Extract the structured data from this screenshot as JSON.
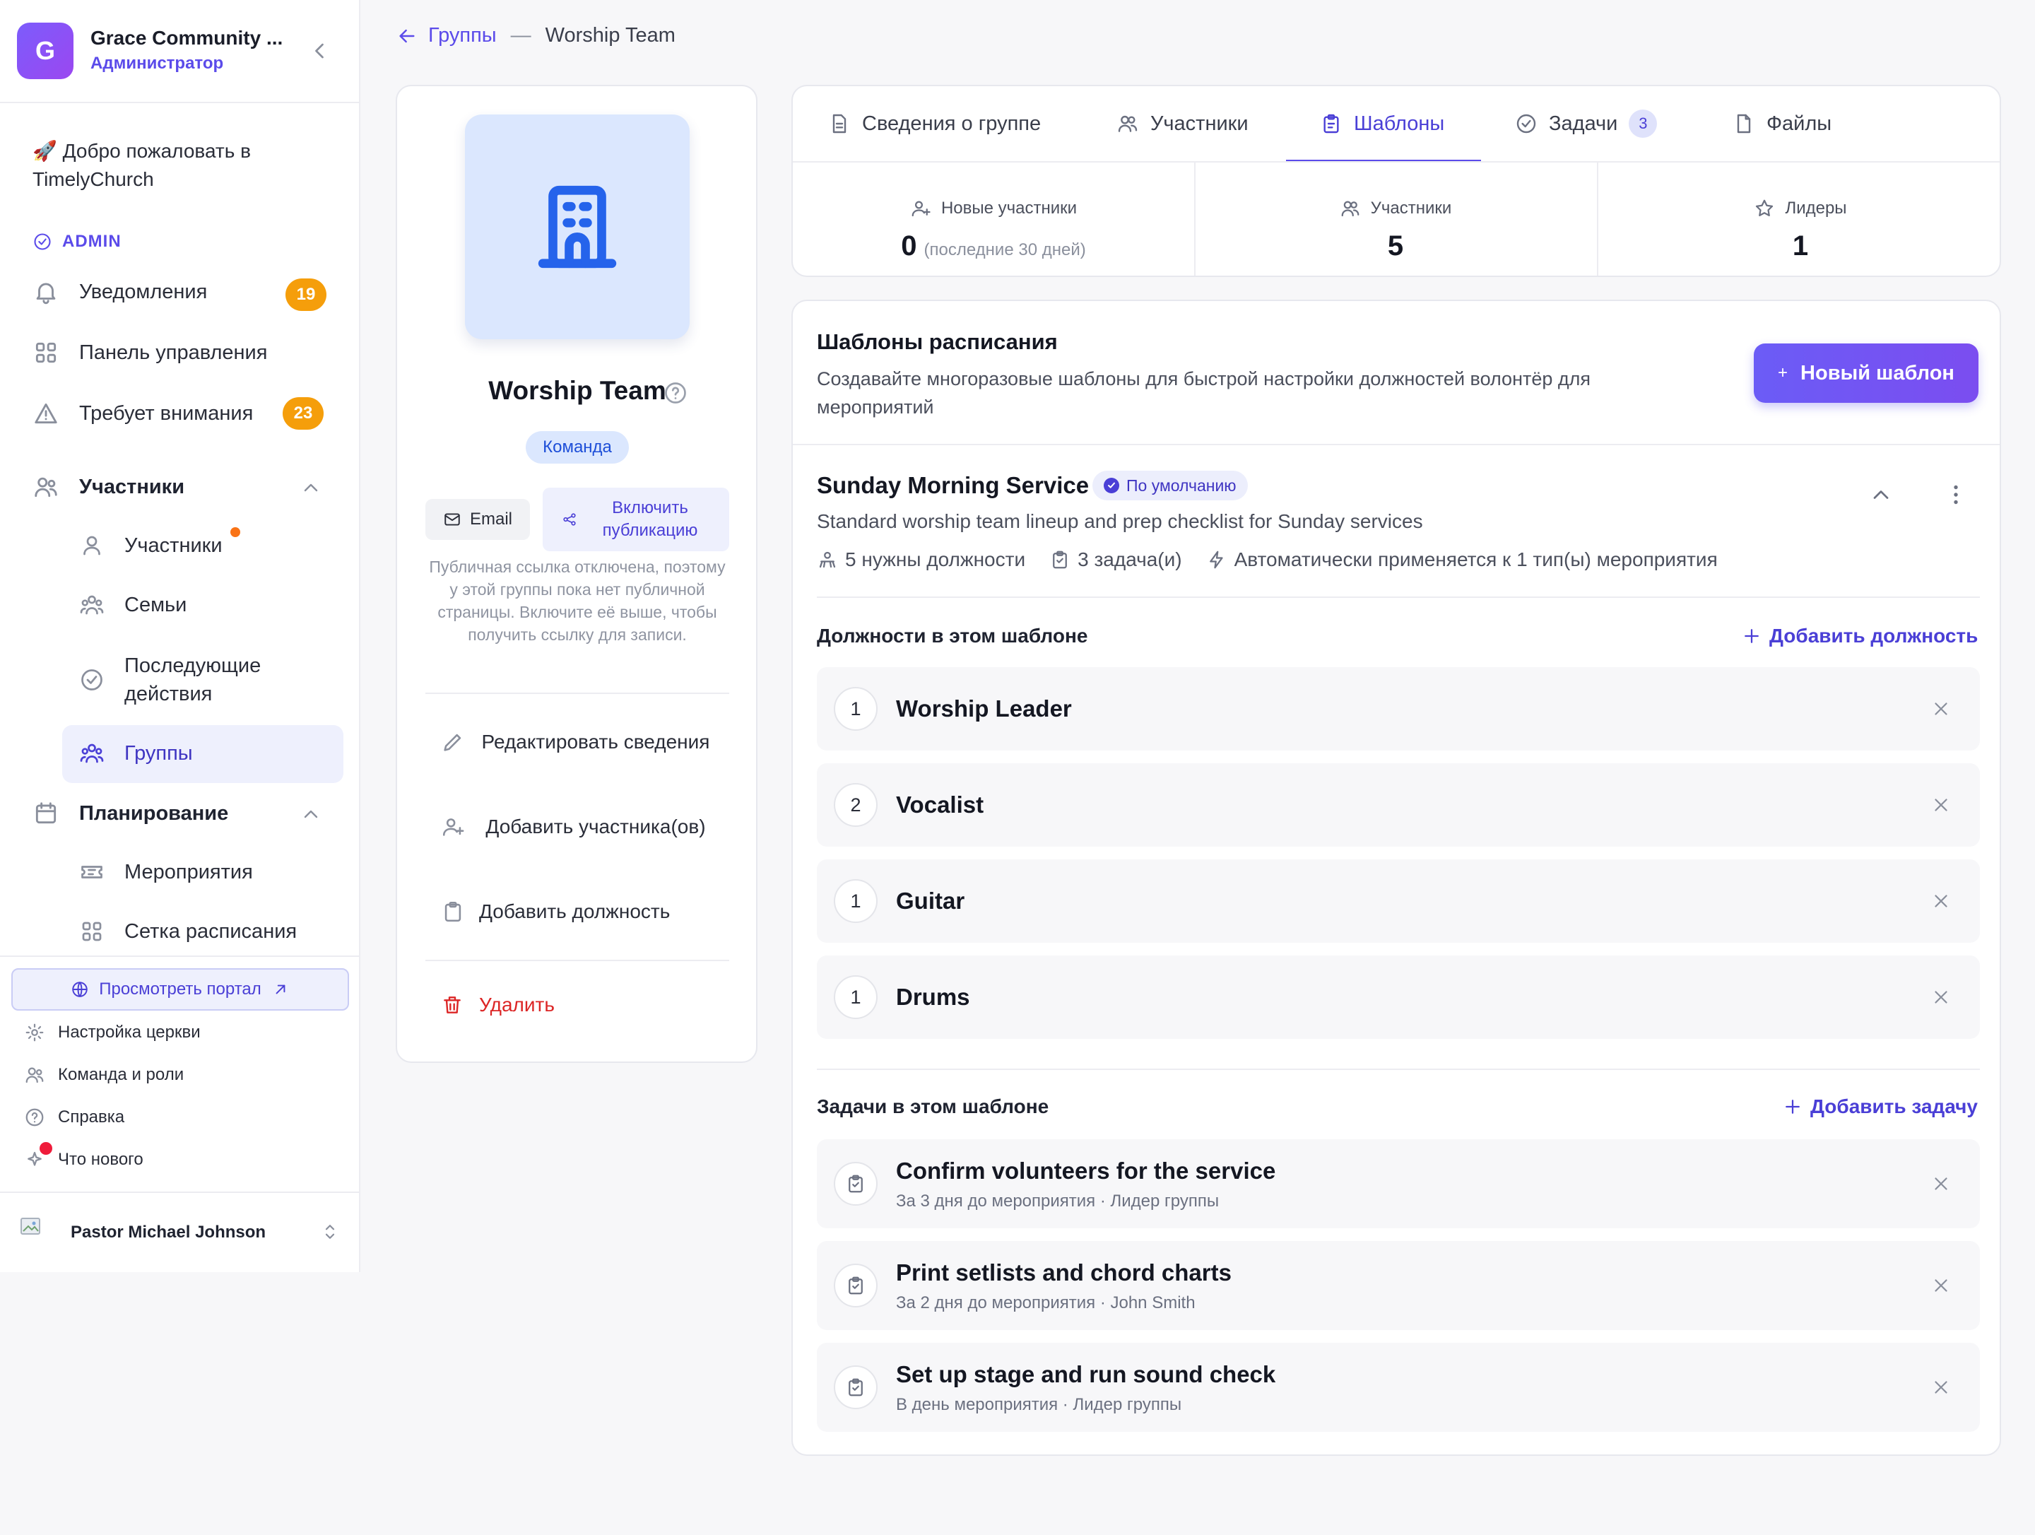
{
  "org": {
    "logo_letter": "G",
    "name": "Grace Community ...",
    "role": "Администратор"
  },
  "sidebar": {
    "welcome": "🚀 Добро пожаловать в TimelyChurch",
    "admin_label": "ADMIN",
    "items": [
      {
        "label": "Уведомления",
        "badge": "19",
        "icon": "bell-icon"
      },
      {
        "label": "Панель управления",
        "icon": "dashboard-icon"
      },
      {
        "label": "Требует внимания",
        "badge": "23",
        "icon": "warning-icon"
      }
    ],
    "section_members": {
      "label": "Участники",
      "children": [
        {
          "label": "Участники",
          "icon": "user-icon"
        },
        {
          "label": "Семьи",
          "icon": "family-icon"
        },
        {
          "label": "Последующие действия",
          "icon": "check-circle-icon"
        },
        {
          "label": "Группы",
          "icon": "groups-icon",
          "active": true
        }
      ]
    },
    "section_planning": {
      "label": "Планирование",
      "children": [
        {
          "label": "Мероприятия",
          "icon": "ticket-icon"
        },
        {
          "label": "Сетка расписания",
          "icon": "grid-icon"
        }
      ]
    },
    "portal_button": "Просмотреть портал",
    "footer": [
      {
        "label": "Настройка церкви",
        "icon": "gear-icon"
      },
      {
        "label": "Команда и роли",
        "icon": "team-icon"
      },
      {
        "label": "Справка",
        "icon": "help-icon"
      },
      {
        "label": "Что нового",
        "icon": "sparkle-icon"
      }
    ],
    "user_name": "Pastor Michael Johnson"
  },
  "breadcrumb": {
    "back_label": "Группы",
    "separator": "—",
    "current": "Worship Team"
  },
  "group": {
    "name": "Worship Team",
    "type_chip": "Команда",
    "email_button": "Email",
    "publish_button": "Включить публикацию",
    "public_note": "Публичная ссылка отключена, поэтому у этой группы пока нет публичной страницы. Включите её выше, чтобы получить ссылку для записи.",
    "actions": {
      "edit": "Редактировать сведения",
      "add_members": "Добавить участника(ов)",
      "add_role": "Добавить должность",
      "delete": "Удалить"
    }
  },
  "tabs": [
    {
      "label": "Сведения о группе",
      "icon": "document-icon"
    },
    {
      "label": "Участники",
      "icon": "users-icon"
    },
    {
      "label": "Шаблоны",
      "icon": "clipboard-icon",
      "active": true
    },
    {
      "label": "Задачи",
      "icon": "check-circle-icon",
      "count": "3"
    },
    {
      "label": "Файлы",
      "icon": "file-icon"
    }
  ],
  "stats": {
    "new_members": {
      "label": "Новые участники",
      "value": "0",
      "note": "(последние 30 дней)"
    },
    "members": {
      "label": "Участники",
      "value": "5"
    },
    "leaders": {
      "label": "Лидеры",
      "value": "1"
    }
  },
  "templates": {
    "title": "Шаблоны расписания",
    "description": "Создавайте многоразовые шаблоны для быстрой настройки должностей волонтёр для мероприятий",
    "new_button": "Новый шаблон",
    "service": {
      "title": "Sunday Morning Service",
      "badge": "По умолчанию",
      "description": "Standard worship team lineup and prep checklist for Sunday services",
      "meta_positions": "5 нужны должности",
      "meta_tasks": "3 задача(и)",
      "meta_auto": "Автоматически применяется к 1 тип(ы) мероприятия"
    },
    "positions_header": "Должности в этом шаблоне",
    "add_position": "Добавить должность",
    "positions": [
      {
        "count": "1",
        "name": "Worship Leader"
      },
      {
        "count": "2",
        "name": "Vocalist"
      },
      {
        "count": "1",
        "name": "Guitar"
      },
      {
        "count": "1",
        "name": "Drums"
      }
    ],
    "tasks_header": "Задачи в этом шаблоне",
    "add_task": "Добавить задачу",
    "tasks": [
      {
        "name": "Confirm volunteers for the service",
        "sub": "За 3 дня до мероприятия · Лидер группы"
      },
      {
        "name": "Print setlists and chord charts",
        "sub": "За 2 дня до мероприятия · John Smith"
      },
      {
        "name": "Set up stage and run sound check",
        "sub": "В день мероприятия · Лидер группы"
      }
    ]
  },
  "colors": {
    "accent": "#5b4bea",
    "badge_orange": "#f59e0b",
    "delete_red": "#dc2626",
    "group_avatar_bg": "#dbe7fe"
  }
}
